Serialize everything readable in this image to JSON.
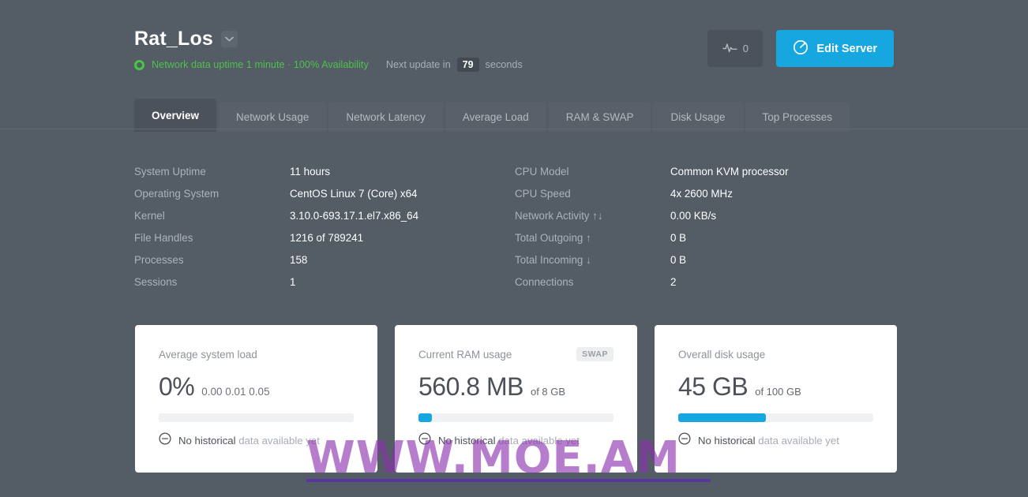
{
  "header": {
    "server_name": "Rat_Los",
    "caret_icon": "chevron-down-icon",
    "status_icon": "status-ring-icon",
    "status_text": "Network data uptime 1 minute · 100% Availability",
    "next_update_prefix": "Next update in",
    "next_update_seconds": "79",
    "next_update_suffix": "seconds",
    "pulse_icon": "activity-pulse-icon",
    "pulse_count": "0",
    "edit_icon": "gauge-circle-icon",
    "edit_label": "Edit Server",
    "accent_color": "#16a7e0",
    "status_color": "#4dc14d"
  },
  "tabs": [
    {
      "label": "Overview",
      "active": true
    },
    {
      "label": "Network Usage",
      "active": false
    },
    {
      "label": "Network Latency",
      "active": false
    },
    {
      "label": "Average Load",
      "active": false
    },
    {
      "label": "RAM & SWAP",
      "active": false
    },
    {
      "label": "Disk Usage",
      "active": false
    },
    {
      "label": "Top Processes",
      "active": false
    }
  ],
  "info": {
    "left": [
      {
        "label": "System Uptime",
        "value": "11 hours"
      },
      {
        "label": "Operating System",
        "value": "CentOS Linux 7 (Core) x64"
      },
      {
        "label": "Kernel",
        "value": "3.10.0-693.17.1.el7.x86_64"
      },
      {
        "label": "File Handles",
        "value": "1216 of 789241"
      },
      {
        "label": "Processes",
        "value": "158"
      },
      {
        "label": "Sessions",
        "value": "1"
      }
    ],
    "right": [
      {
        "label": "CPU Model",
        "value": "Common KVM processor"
      },
      {
        "label": "CPU Speed",
        "value": "4x 2600 MHz"
      },
      {
        "label": "Network Activity ↑↓",
        "value": "0.00 KB/s"
      },
      {
        "label": "Total Outgoing ↑",
        "value": "0 B"
      },
      {
        "label": "Total Incoming ↓",
        "value": "0 B"
      },
      {
        "label": "Connections",
        "value": "2"
      }
    ]
  },
  "cards": [
    {
      "title": "Average system load",
      "badge": null,
      "metric": "0%",
      "sub": "0.00 0.01 0.05",
      "bar_percent": 0,
      "foot_icon": "minus-circle-icon",
      "foot_strong": "No historical",
      "foot_light": "data available yet"
    },
    {
      "title": "Current RAM usage",
      "badge": "SWAP",
      "metric": "560.8 MB",
      "sub": "of 8 GB",
      "bar_percent": 7,
      "foot_icon": "minus-circle-icon",
      "foot_strong": "No historical",
      "foot_light": "data available yet"
    },
    {
      "title": "Overall disk usage",
      "badge": null,
      "metric": "45 GB",
      "sub": "of 100 GB",
      "bar_percent": 45,
      "foot_icon": "minus-circle-icon",
      "foot_strong": "No historical",
      "foot_light": "data available yet"
    }
  ],
  "watermark": {
    "text": "WWW.MOE.AM"
  }
}
